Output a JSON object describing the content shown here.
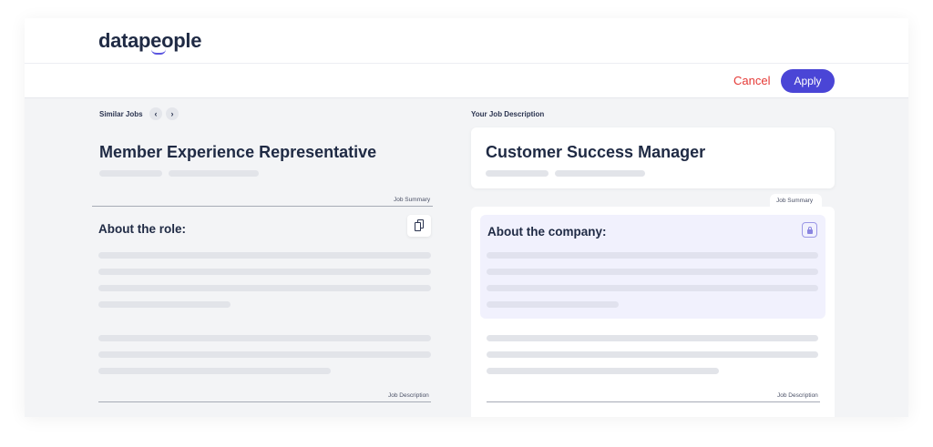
{
  "app": {
    "logo": "datapeople"
  },
  "toolbar": {
    "cancel_label": "Cancel",
    "apply_label": "Apply"
  },
  "left": {
    "header_label": "Similar Jobs",
    "nav_prev": "‹",
    "nav_next": "›",
    "job_title": "Member Experience Representative",
    "summary_label": "Job Summary",
    "section_title": "About the role:",
    "description_label": "Job Description",
    "copy_icon": "copy-icon"
  },
  "right": {
    "header_label": "Your Job Description",
    "job_title": "Customer Success Manager",
    "summary_tab": "Job Summary",
    "section_title": "About the company:",
    "description_label": "Job Description",
    "lock_icon": "lock-icon"
  },
  "colors": {
    "accent": "#4a45d6",
    "cancel": "#e53935",
    "highlight": "#f1f1fd"
  }
}
